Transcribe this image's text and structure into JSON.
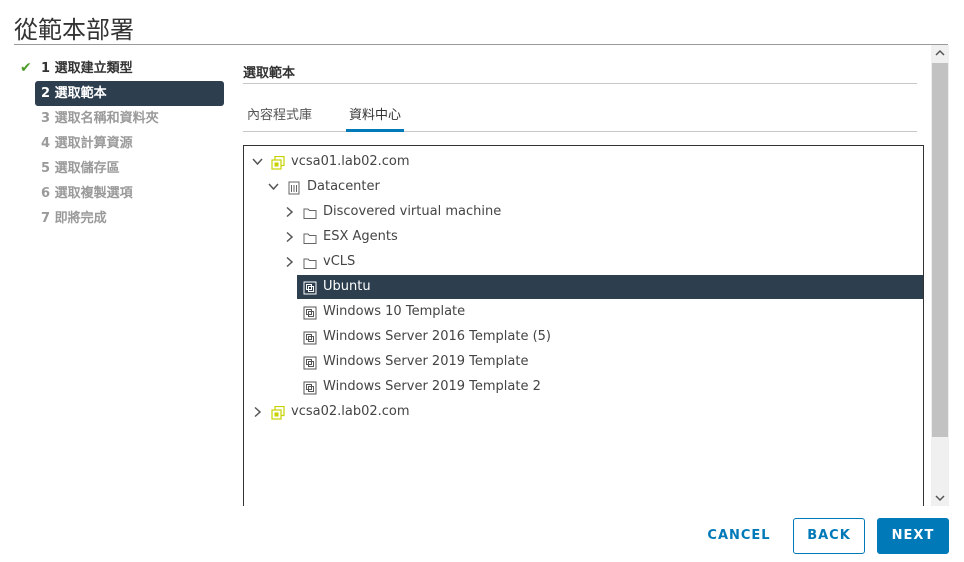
{
  "dialog": {
    "title": "從範本部署"
  },
  "steps": [
    {
      "label": "1 選取建立類型",
      "state": "done"
    },
    {
      "label": "2 選取範本",
      "state": "active"
    },
    {
      "label": "3 選取名稱和資料夾",
      "state": "pending"
    },
    {
      "label": "4 選取計算資源",
      "state": "pending"
    },
    {
      "label": "5 選取儲存區",
      "state": "pending"
    },
    {
      "label": "6 選取複製選項",
      "state": "pending"
    },
    {
      "label": "7 即將完成",
      "state": "pending"
    }
  ],
  "section": {
    "title": "選取範本"
  },
  "tabs": [
    {
      "label": "內容程式庫",
      "active": false
    },
    {
      "label": "資料中心",
      "active": true
    }
  ],
  "tree": [
    {
      "label": "vcsa01.lab02.com",
      "icon": "vcenter-icon",
      "expanded": true,
      "chevron": "chevron-down"
    },
    {
      "label": "Datacenter",
      "icon": "datacenter-icon",
      "expanded": true,
      "chevron": "chevron-down"
    },
    {
      "label": "Discovered virtual machine",
      "icon": "folder-icon",
      "expanded": false,
      "chevron": "chevron-right"
    },
    {
      "label": "ESX Agents",
      "icon": "folder-icon",
      "expanded": false,
      "chevron": "chevron-right"
    },
    {
      "label": "vCLS",
      "icon": "folder-icon",
      "expanded": false,
      "chevron": "chevron-right"
    },
    {
      "label": "Ubuntu",
      "icon": "vm-template-icon",
      "selected": true
    },
    {
      "label": "Windows 10 Template",
      "icon": "vm-template-icon"
    },
    {
      "label": "Windows Server 2016 Template (5)",
      "icon": "vm-template-icon"
    },
    {
      "label": "Windows Server 2019 Template",
      "icon": "vm-template-icon"
    },
    {
      "label": "Windows Server 2019 Template 2",
      "icon": "vm-template-icon"
    },
    {
      "label": "vcsa02.lab02.com",
      "icon": "vcenter-icon",
      "expanded": false,
      "chevron": "chevron-right"
    }
  ],
  "footer": {
    "cancel_label": "CANCEL",
    "back_label": "BACK",
    "next_label": "NEXT"
  },
  "colors": {
    "accent": "#0079b8",
    "selected_bg": "#2d3e4e",
    "check": "#4d9b29",
    "vcenter": "#c7d300"
  }
}
